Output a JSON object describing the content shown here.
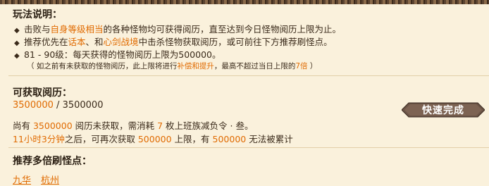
{
  "rules": {
    "title": "玩法说明：",
    "line1": {
      "a": "击败与",
      "b": "自身等级相当",
      "c": "的各种怪物均可获得阅历，直至达到今日怪物阅历上限为止。"
    },
    "line2": {
      "a": "推荐优先在",
      "b": "话本",
      "c": "、和",
      "d": "心剑战境",
      "e": "中击杀怪物获取阅历，或可前往下方推荐刷怪点。"
    },
    "line3": "81 - 90级：每天获得的怪物阅历上限为500000。",
    "note": {
      "a": "（ 如之前有未获取的怪物阅历，此上限将进行",
      "b": "补偿和提升",
      "c": "，最高不超过当日上限的",
      "d": "7倍",
      "e": " ）"
    }
  },
  "exp": {
    "title": "可获取阅历：",
    "current": "3500000",
    "sep": " / ",
    "max": "3500000",
    "line1": {
      "a": "尚有 ",
      "b": "3500000",
      "c": " 阅历未获取，需消耗 ",
      "d": "7",
      "e": " 枚上班族减负令 · 叁。"
    },
    "line2": {
      "a": "11小时3分钟",
      "b": "之后，可再次获取 ",
      "c": "500000",
      "d": " 上限，有 ",
      "e": "500000",
      "f": " 无法被累计"
    },
    "quick_button": "快速完成"
  },
  "spots": {
    "title": "推荐多倍刷怪点：",
    "links": [
      "九华",
      "杭州"
    ]
  }
}
